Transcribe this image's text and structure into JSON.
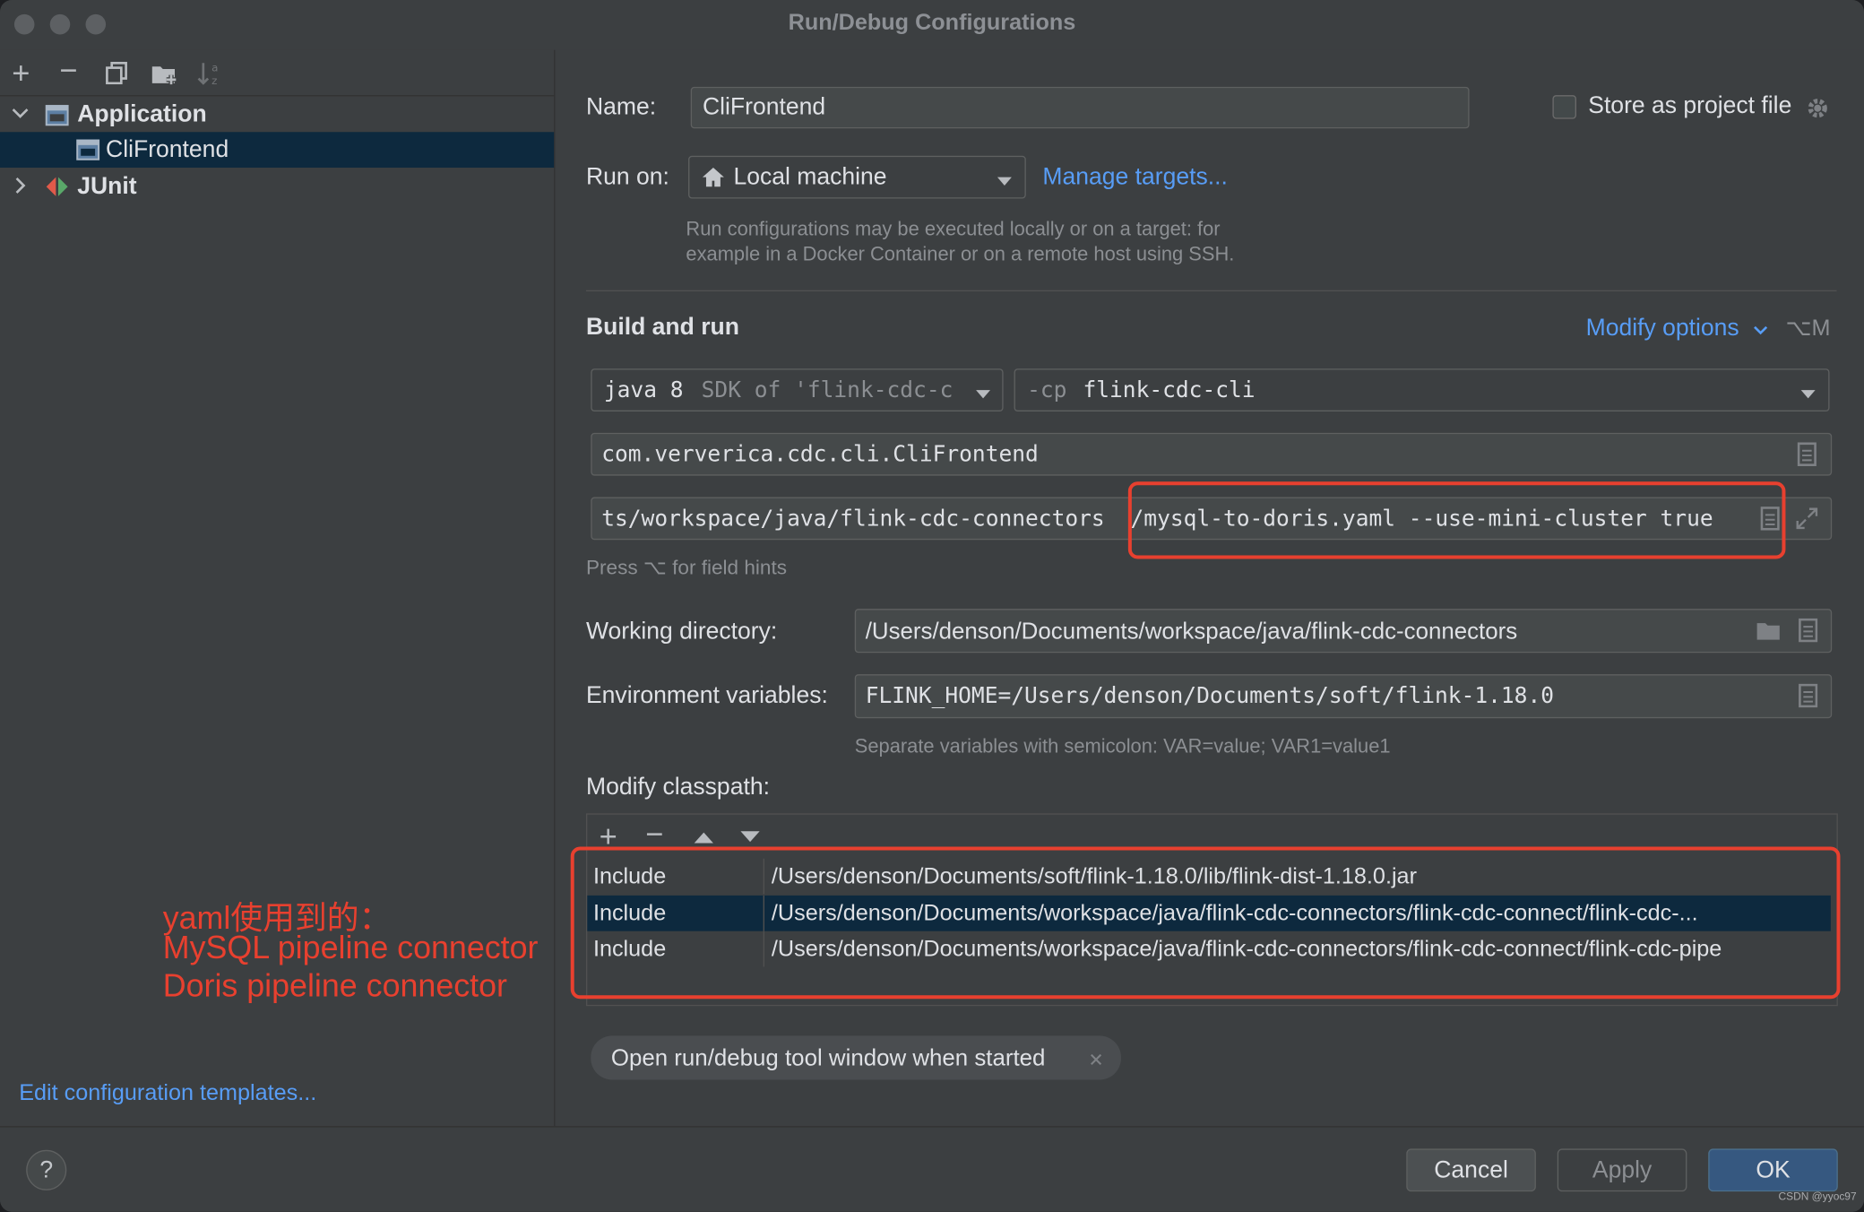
{
  "window": {
    "title": "Run/Debug Configurations"
  },
  "tree": {
    "items": [
      {
        "label": "Application",
        "icon": "application-config-icon",
        "expanded": true
      },
      {
        "label": "CliFrontend",
        "icon": "application-config-icon",
        "selected": true
      },
      {
        "label": "JUnit",
        "icon": "junit-icon",
        "expanded": false
      }
    ]
  },
  "toolbar_icons": [
    "add-icon",
    "remove-icon",
    "copy-icon",
    "new-folder-icon",
    "sort-icon"
  ],
  "form": {
    "name_label": "Name:",
    "name_value": "CliFrontend",
    "store_label": "Store as project file",
    "run_on_label": "Run on:",
    "run_on_value": "Local machine",
    "manage_targets": "Manage targets...",
    "run_on_hint_1": "Run configurations may be executed locally or on a target: for",
    "run_on_hint_2": "example in a Docker Container or on a remote host using SSH.",
    "build_and_run": "Build and run",
    "modify_options": "Modify options",
    "modify_shortcut": "⌥M",
    "jdk_java": "java 8",
    "jdk_sdk": "SDK of 'flink-cdc-c",
    "cp_prefix": "-cp",
    "cp_value": "flink-cdc-cli",
    "main_class": "com.ververica.cdc.cli.CliFrontend",
    "program_args_a": "ts/workspace/java/flink-cdc-connectors",
    "program_args_b": "/mysql-to-doris.yaml --use-mini-cluster true",
    "field_hint": "Press ⌥ for field hints",
    "workdir_label": "Working directory:",
    "workdir_value": "/Users/denson/Documents/workspace/java/flink-cdc-connectors",
    "env_label": "Environment variables:",
    "env_value": "FLINK_HOME=/Users/denson/Documents/soft/flink-1.18.0",
    "env_hint": "Separate variables with semicolon: VAR=value; VAR1=value1",
    "classpath_label": "Modify classpath:",
    "classpath_rows": [
      {
        "mode": "Include",
        "path": "/Users/denson/Documents/soft/flink-1.18.0/lib/flink-dist-1.18.0.jar"
      },
      {
        "mode": "Include",
        "path": "/Users/denson/Documents/workspace/java/flink-cdc-connectors/flink-cdc-connect/flink-cdc-..."
      },
      {
        "mode": "Include",
        "path": "/Users/denson/Documents/workspace/java/flink-cdc-connectors/flink-cdc-connect/flink-cdc-pipe"
      }
    ],
    "chip_label": "Open run/debug tool window when started"
  },
  "annotation": {
    "line1": "yaml使用到的：",
    "line2": "MySQL pipeline connector",
    "line3": "Doris pipeline connector",
    "color": "#e8402f"
  },
  "footer": {
    "edit_templates": "Edit configuration templates...",
    "help": "?",
    "cancel": "Cancel",
    "apply": "Apply",
    "ok": "OK",
    "watermark": "CSDN @yyoc97"
  },
  "colors": {
    "background": "#3c3f41",
    "selection": "#0d293e",
    "link": "#589df6",
    "ok_button": "#365880"
  }
}
